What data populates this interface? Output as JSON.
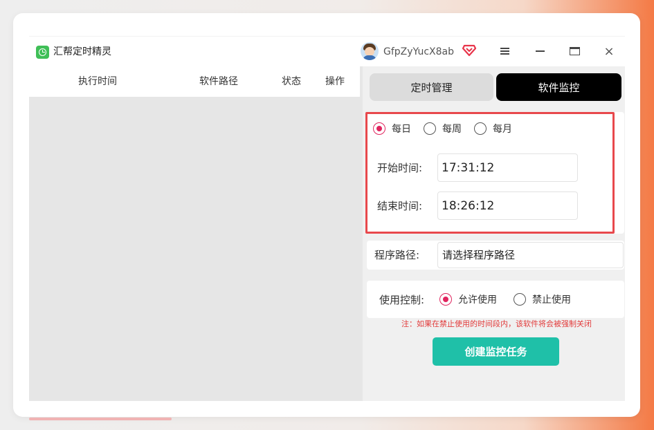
{
  "app": {
    "title": "汇帮定时精灵"
  },
  "user": {
    "name": "GfpZyYucX8ab"
  },
  "icons": {
    "app_logo": "alarm-clock-icon",
    "vip": "vip-diamond-icon",
    "menu": "hamburger-menu-icon",
    "minimize": "minimize-icon",
    "maximize": "maximize-icon",
    "close": "close-icon"
  },
  "window_controls": {
    "close_glyph": "×"
  },
  "table": {
    "headers": [
      "执行时间",
      "软件路径",
      "状态",
      "操作"
    ],
    "rows": []
  },
  "tabs": [
    {
      "label": "定时管理",
      "active": false
    },
    {
      "label": "软件监控",
      "active": true
    }
  ],
  "frequency": {
    "options": [
      {
        "label": "每日",
        "checked": true
      },
      {
        "label": "每周",
        "checked": false
      },
      {
        "label": "每月",
        "checked": false
      }
    ]
  },
  "start_time": {
    "label": "开始时间:",
    "value": "17:31:12"
  },
  "end_time": {
    "label": "结束时间:",
    "value": "18:26:12"
  },
  "program_path": {
    "label": "程序路径:",
    "value": "请选择程序路径"
  },
  "usage": {
    "label": "使用控制:",
    "options": [
      {
        "label": "允许使用",
        "checked": true
      },
      {
        "label": "禁止使用",
        "checked": false
      }
    ]
  },
  "note": "注：如果在禁止使用的时间段内，该软件将会被强制关闭",
  "create_button": "创建监控任务",
  "colors": {
    "accent": "#e0245e",
    "highlight_frame": "#e8484c",
    "create_button": "#1fc0a8",
    "active_tab": "#000000",
    "note_text": "#e23b3b",
    "app_logo": "#3fbf57"
  }
}
